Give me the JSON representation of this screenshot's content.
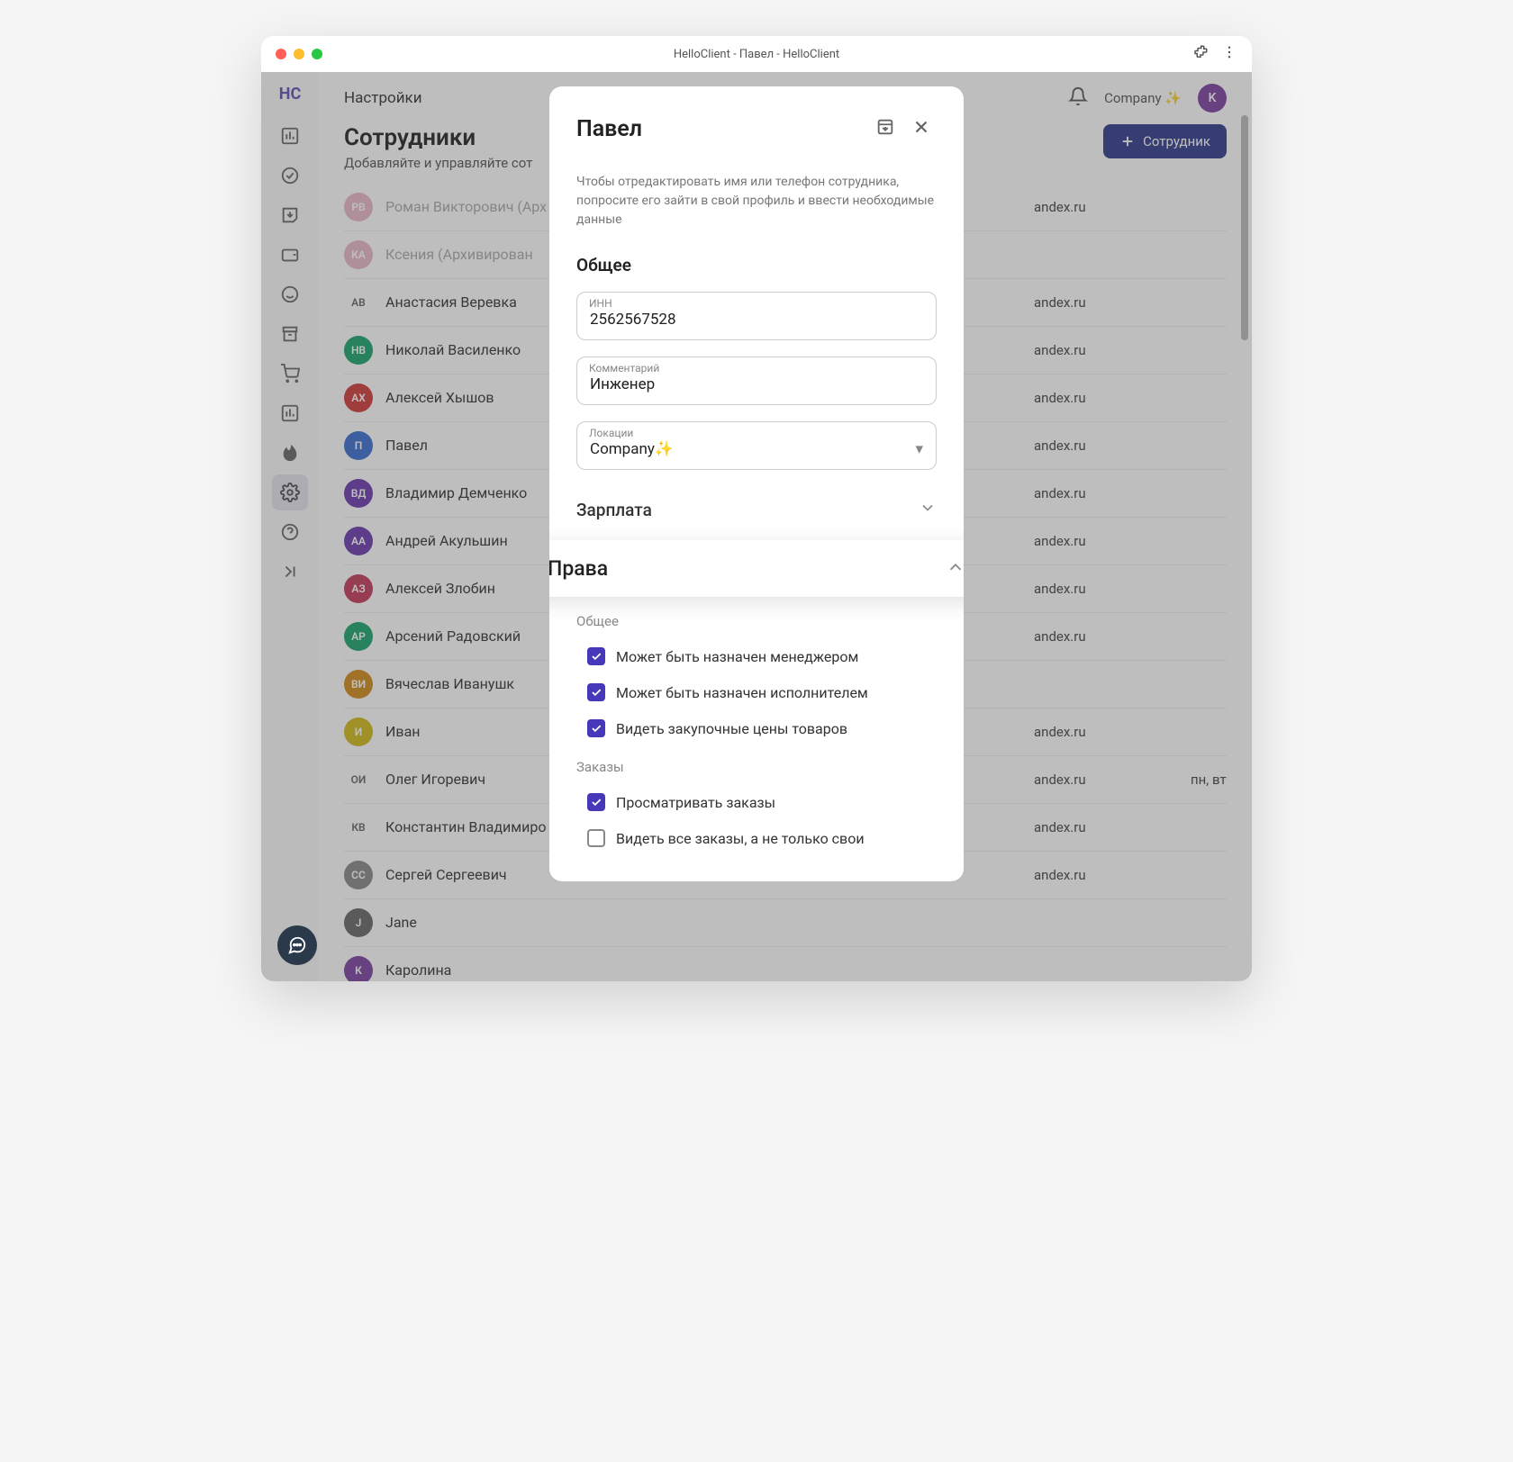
{
  "window_title": "HelloClient - Павел - HelloClient",
  "logo": "HC",
  "topbar": {
    "title": "Настройки",
    "company": "Company ✨",
    "avatar": "K"
  },
  "page": {
    "heading": "Сотрудники",
    "sub": "Добавляйте и управляйте сот",
    "add_btn": "Сотрудник"
  },
  "employees": [
    {
      "initials": "РВ",
      "name": "Роман Викторович (Арх",
      "email": "andex.ru",
      "archived": true,
      "color": "#e8b7c6"
    },
    {
      "initials": "КА",
      "name": "Ксения (Архивирован",
      "email": "",
      "archived": true,
      "color": "#e8b7c6"
    },
    {
      "initials": "АВ",
      "name": "Анастасия Веревка",
      "email": "andex.ru",
      "archived": false,
      "color": "#ffffff",
      "text_av": true
    },
    {
      "initials": "НВ",
      "name": "Николай Василенко",
      "email": "andex.ru",
      "archived": false,
      "color": "#1aa36b"
    },
    {
      "initials": "АХ",
      "name": "Алексей Хышов",
      "email": "andex.ru",
      "archived": false,
      "color": "#d03a3a"
    },
    {
      "initials": "П",
      "name": "Павел",
      "email": "andex.ru",
      "archived": false,
      "color": "#3a6ed0"
    },
    {
      "initials": "ВД",
      "name": "Владимир Демченко",
      "email": "andex.ru",
      "archived": false,
      "color": "#6a3ab0"
    },
    {
      "initials": "АА",
      "name": "Андрей Акульшин",
      "email": "andex.ru",
      "archived": false,
      "color": "#6a3ab0"
    },
    {
      "initials": "АЗ",
      "name": "Алексей Злобин",
      "email": "andex.ru",
      "archived": false,
      "color": "#c23a5a"
    },
    {
      "initials": "АР",
      "name": "Арсений Радовский",
      "email": "andex.ru",
      "archived": false,
      "color": "#1aa36b"
    },
    {
      "initials": "ВИ",
      "name": "Вячеслав Иванушк",
      "email": "",
      "archived": false,
      "color": "#d08a1a"
    },
    {
      "initials": "И",
      "name": "Иван",
      "email": "andex.ru",
      "archived": false,
      "color": "#d0b81a"
    },
    {
      "initials": "ОИ",
      "name": "Олег Игоревич",
      "email": "andex.ru",
      "archived": false,
      "color": "#ffffff",
      "text_av": true,
      "sched": "пн, вт"
    },
    {
      "initials": "КВ",
      "name": "Константин Владимиро",
      "email": "andex.ru",
      "archived": false,
      "color": "#ffffff",
      "text_av": true
    },
    {
      "initials": "СС",
      "name": "Сергей Сергеевич",
      "email": "andex.ru",
      "archived": false,
      "color": "#888888"
    },
    {
      "initials": "J",
      "name": "Jane",
      "email": "",
      "archived": false,
      "color": "#666666"
    },
    {
      "initials": "К",
      "name": "Каролина",
      "email": "",
      "archived": false,
      "color": "#7b3fa0"
    }
  ],
  "dialog": {
    "title": "Павел",
    "hint": "Чтобы отредактировать имя или телефон сотрудника, попросите его зайти в свой профиль и ввести необходимые данные",
    "section_general": "Общее",
    "inn_label": "ИНН",
    "inn_value": "2562567528",
    "comment_label": "Комментарий",
    "comment_value": "Инженер",
    "locations_label": "Локации",
    "locations_value": "Company✨",
    "salary": "Зарплата",
    "perms_title": "Права",
    "perms_general": "Общее",
    "perm1": "Может быть назначен менеджером",
    "perm2": "Может быть назначен исполнителем",
    "perm3": "Видеть закупочные цены товаров",
    "perms_orders": "Заказы",
    "perm4": "Просматривать заказы",
    "perm5": "Видеть все заказы, а не только свои"
  }
}
